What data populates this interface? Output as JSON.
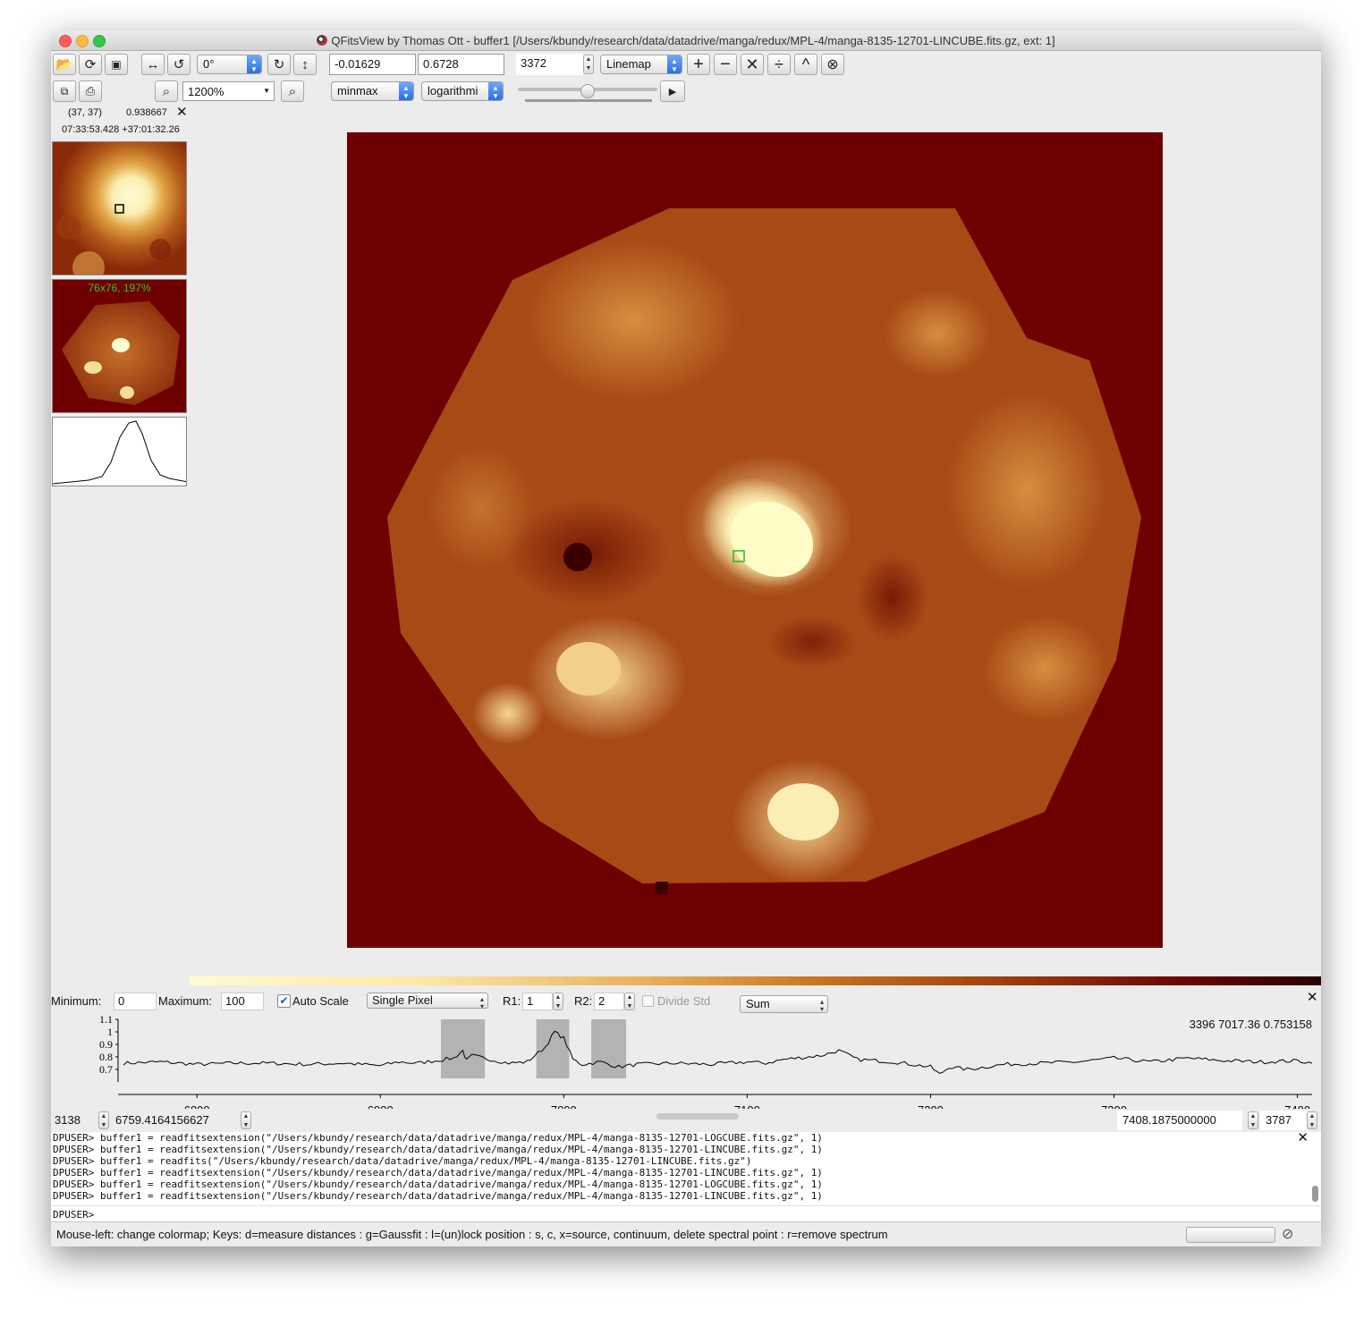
{
  "window": {
    "title": "QFitsView by Thomas Ott - buffer1 [/Users/kbundy/research/data/datadrive/manga/redux/MPL-4/manga-8135-12701-LINCUBE.fits.gz, ext: 1]"
  },
  "toolbar": {
    "rotation": "0°",
    "zoom": "1200%",
    "min_value": "-0.01629",
    "max_value": "0.6728",
    "channel": "3372",
    "map_mode": "Linemap",
    "scale_mode": "minmax",
    "scale_type": "logarithmi",
    "play_icon": "▶"
  },
  "info": {
    "pixel": "(37, 37)",
    "value": "0.938667",
    "coords": "07:33:53.428 +37:01:32.26",
    "overview_label": "76x76, 197%"
  },
  "spectrum_controls": {
    "min_label": "Minimum:",
    "min_value": "0",
    "max_label": "Maximum:",
    "max_value": "100",
    "autoscale_label": "Auto Scale",
    "mode": "Single Pixel",
    "r1_label": "R1:",
    "r1_value": "1",
    "r2_label": "R2:",
    "r2_value": "2",
    "divide_label": "Divide Std",
    "combine": "Sum",
    "readout": "3396 7017.36 0.753158"
  },
  "chart_data": {
    "type": "line",
    "xlim": [
      6757,
      7408
    ],
    "ylim": [
      0.6,
      1.1
    ],
    "xticks": [
      "6800",
      "6900",
      "7000",
      "7100",
      "7200",
      "7300",
      "7400"
    ],
    "xtick_values": [
      6800,
      6900,
      7000,
      7100,
      7200,
      7300,
      7400
    ],
    "yticks": [
      "1.1",
      "1",
      "0.9",
      "0.8",
      "0.7"
    ],
    "ytick_values": [
      1.1,
      1.0,
      0.9,
      0.8,
      0.7
    ],
    "x": [
      6760,
      6780,
      6800,
      6820,
      6840,
      6860,
      6880,
      6900,
      6910,
      6920,
      6930,
      6940,
      6945,
      6947,
      6950,
      6960,
      6970,
      6980,
      6990,
      6995,
      7000,
      7005,
      7010,
      7020,
      7030,
      7040,
      7060,
      7080,
      7100,
      7110,
      7120,
      7140,
      7150,
      7160,
      7180,
      7200,
      7205,
      7210,
      7220,
      7240,
      7260,
      7280,
      7300,
      7320,
      7340,
      7360,
      7380,
      7400,
      7408
    ],
    "values": [
      0.75,
      0.76,
      0.74,
      0.75,
      0.75,
      0.74,
      0.75,
      0.73,
      0.76,
      0.75,
      0.77,
      0.79,
      0.85,
      0.77,
      0.81,
      0.78,
      0.75,
      0.76,
      0.88,
      1.0,
      0.95,
      0.78,
      0.74,
      0.76,
      0.72,
      0.74,
      0.75,
      0.74,
      0.76,
      0.75,
      0.78,
      0.81,
      0.85,
      0.78,
      0.76,
      0.72,
      0.66,
      0.72,
      0.7,
      0.74,
      0.75,
      0.76,
      0.79,
      0.76,
      0.79,
      0.77,
      0.76,
      0.77,
      0.75
    ],
    "bands": [
      [
        6933,
        6957
      ],
      [
        6985,
        7003
      ],
      [
        7015,
        7034
      ]
    ]
  },
  "range": {
    "start_channel": "3138",
    "start_wave": "6759.4164156627",
    "end_wave": "7408.1875000000",
    "end_channel": "3787"
  },
  "console": {
    "lines": [
      "DPUSER> buffer1 = readfitsextension(\"/Users/kbundy/research/data/datadrive/manga/redux/MPL-4/manga-8135-12701-LOGCUBE.fits.gz\", 1)",
      "DPUSER> buffer1 = readfitsextension(\"/Users/kbundy/research/data/datadrive/manga/redux/MPL-4/manga-8135-12701-LINCUBE.fits.gz\", 1)",
      "DPUSER> buffer1 = readfits(\"/Users/kbundy/research/data/datadrive/manga/redux/MPL-4/manga-8135-12701-LINCUBE.fits.gz\")",
      "DPUSER> buffer1 = readfitsextension(\"/Users/kbundy/research/data/datadrive/manga/redux/MPL-4/manga-8135-12701-LINCUBE.fits.gz\", 1)",
      "DPUSER> buffer1 = readfitsextension(\"/Users/kbundy/research/data/datadrive/manga/redux/MPL-4/manga-8135-12701-LOGCUBE.fits.gz\", 1)",
      "DPUSER> buffer1 = readfitsextension(\"/Users/kbundy/research/data/datadrive/manga/redux/MPL-4/manga-8135-12701-LINCUBE.fits.gz\", 1)"
    ],
    "prompt": "DPUSER>"
  },
  "status": {
    "text": "Mouse-left: change colormap; Keys: d=measure distances : g=Gaussfit : l=(un)lock position : s, c, x=source, continuum, delete spectral point : r=remove spectrum"
  },
  "colors": {
    "background_red": "#6f0000",
    "spectrum_band": "#a9a9a9"
  }
}
